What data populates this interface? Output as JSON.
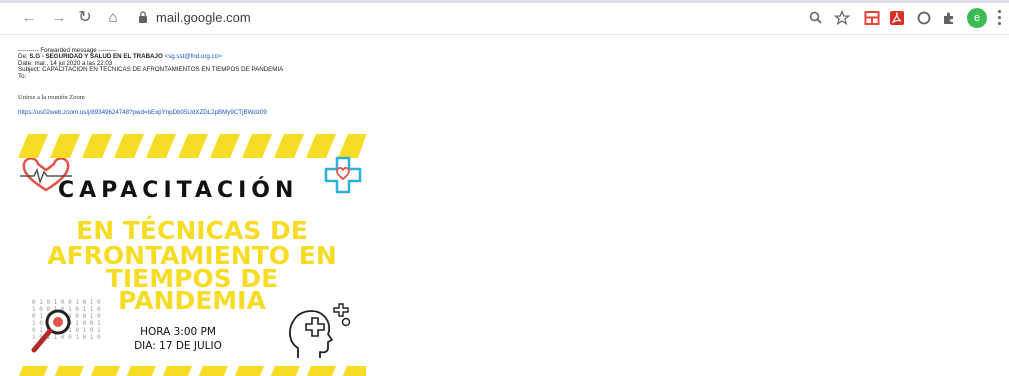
{
  "browser": {
    "url": "mail.google.com",
    "profile_initial": "e"
  },
  "email": {
    "forward_header": "---------- Forwarded message ---------",
    "from_label": "De:",
    "from_name": "S.G - SEGURIDAD Y SALUD EN EL TRABAJO",
    "from_email": "<sg.sst@fnd.org.co>",
    "date": "Date: mar., 14 jul 2020 a las 22:03",
    "subject": "Subject: CAPACITACION EN TECNICAS DE AFRONTAMIENTOS EN TIEMPOS DE PANDEMIA",
    "to": "To:",
    "zoom_prompt": "Unirse a la reunión Zoom",
    "zoom_link": "https://us02web.zoom.us/j/89349624748?pwd=bExpYnpDb05UdXZDL2pBMy9CTjBWdz09"
  },
  "flyer": {
    "title": "CAPACITACIÓN",
    "subtitle_lines": [
      "EN TÉCNICAS DE",
      "AFRONTAMIENTO EN",
      "TIEMPOS DE",
      "PANDEMIA"
    ],
    "time": "HORA 3:00 PM",
    "day": "DIA: 17 DE JULIO"
  },
  "colors": {
    "accent_yellow": "#f7dc26",
    "heart_red": "#e4534a",
    "cross_blue": "#2ab0d9"
  }
}
